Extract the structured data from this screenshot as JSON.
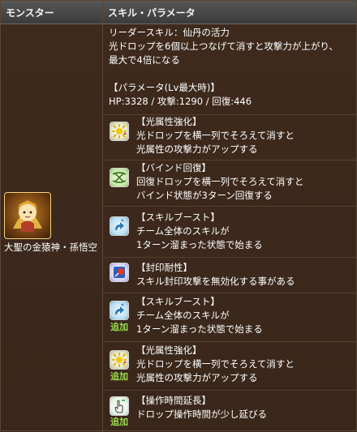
{
  "header": {
    "col1": "モンスター",
    "col2": "スキル・パラメータ"
  },
  "monster": {
    "name": "大聖の金猿神・孫悟空"
  },
  "leader": {
    "line1": "リーダースキル：仙丹の活力",
    "line2": "光ドロップを6個以上つなげて消すと攻撃力が上がり、",
    "line3": "最大で4倍になる"
  },
  "params": {
    "title": "【パラメータ(Lv最大時)】",
    "stats": "HP:3328 / 攻撃:1290 / 回復:446"
  },
  "awakenings": [
    {
      "title": "【光属性強化】",
      "line1": "光ドロップを横一列でそろえて消すと",
      "line2": "光属性の攻撃力がアップする",
      "added": ""
    },
    {
      "title": "【バインド回復】",
      "line1": "回復ドロップを横一列でそろえて消すと",
      "line2": "バインド状態が3ターン回復する",
      "added": ""
    },
    {
      "title": "【スキルブースト】",
      "line1": "チーム全体のスキルが",
      "line2": "1ターン溜まった状態で始まる",
      "added": ""
    },
    {
      "title": "【封印耐性】",
      "line1": "スキル封印攻撃を無効化する事がある",
      "line2": "",
      "added": ""
    },
    {
      "title": "【スキルブースト】",
      "line1": "チーム全体のスキルが",
      "line2": "1ターン溜まった状態で始まる",
      "added": "追加"
    },
    {
      "title": "【光属性強化】",
      "line1": "光ドロップを横一列でそろえて消すと",
      "line2": "光属性の攻撃力がアップする",
      "added": "追加"
    },
    {
      "title": "【操作時間延長】",
      "line1": "ドロップ操作時間が少し延びる",
      "line2": "",
      "added": "追加"
    }
  ],
  "colors": {
    "background": "#3b281c",
    "header": "#4a4a4a",
    "added": "#9bdc4a"
  },
  "icons": [
    "light-enhance-icon",
    "bind-recovery-icon",
    "skill-boost-icon",
    "seal-resistance-icon",
    "skill-boost-icon",
    "light-enhance-icon",
    "time-extend-icon"
  ]
}
